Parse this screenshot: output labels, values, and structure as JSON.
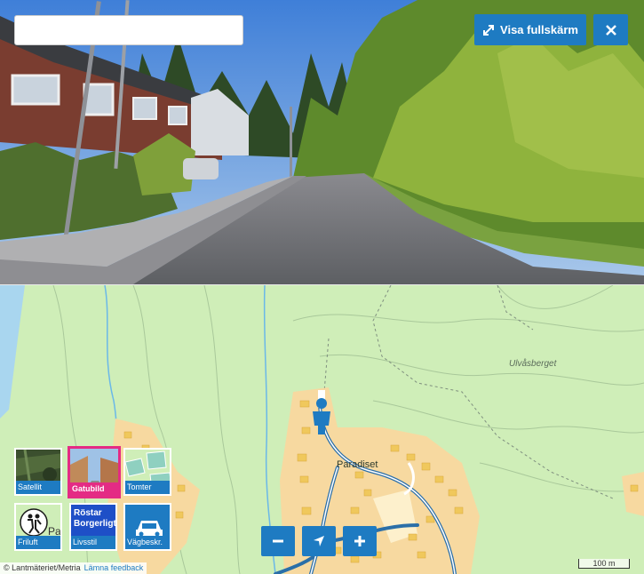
{
  "search": {
    "placeholder": "",
    "value": ""
  },
  "toolbar": {
    "fullscreen_label": "Visa fullskärm",
    "fullscreen_icon": "expand-arrows-icon",
    "close_icon": "close-x-icon"
  },
  "map": {
    "places": {
      "ulvasberget": "Ulvåsberget",
      "paradiset": "Paradiset"
    },
    "layers": [
      {
        "label": "Satellit",
        "active": false
      },
      {
        "label": "Gatubild",
        "active": true
      },
      {
        "label": "Tomter",
        "active": false
      },
      {
        "label": "Friluft",
        "active": false
      },
      {
        "label": "Livsstil",
        "active": false,
        "badge_line1": "Röstar",
        "badge_line2": "Borgerligt"
      },
      {
        "label": "Vägbeskr.",
        "active": false
      }
    ],
    "controls": {
      "zoom_out": "minus-icon",
      "locate": "location-arrow-icon",
      "zoom_in": "plus-icon"
    },
    "attribution": "© Lantmäteriet/Metria",
    "feedback_link": "Lämna feedback",
    "scale": "100 m",
    "colors": {
      "accent": "#1e7bc2",
      "active_layer": "#e42b84",
      "land": "#cfeeb8",
      "roads": "#2b6fa8",
      "buildings": "#f5dc8a"
    }
  }
}
